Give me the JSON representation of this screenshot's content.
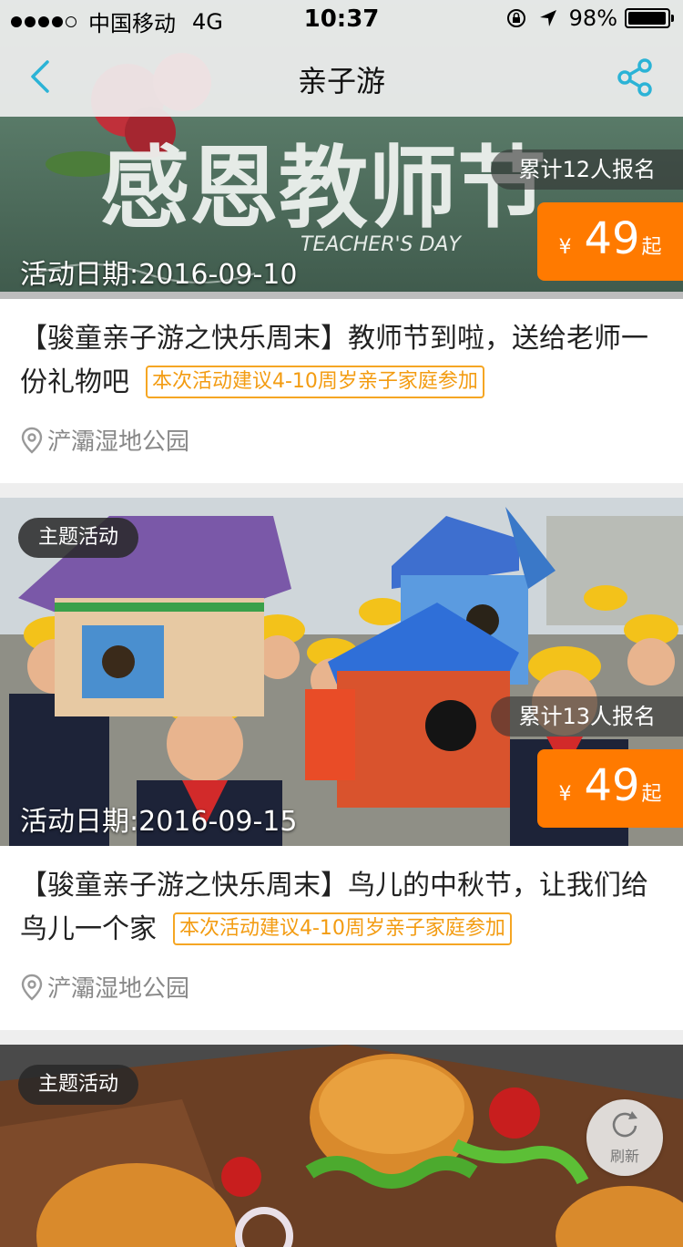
{
  "status_bar": {
    "carrier": "中国移动",
    "network": "4G",
    "time": "10:37",
    "battery": "98%",
    "battery_level": 0.98,
    "signal_bars_filled": 4,
    "signal_bars_total": 5
  },
  "nav": {
    "title": "亲子游",
    "back_icon": "chevron-left-icon",
    "share_icon": "share-icon",
    "accent_color": "#2bb3d6"
  },
  "activities": [
    {
      "registered": "累计12人报名",
      "price_currency": "¥",
      "price_value": "49",
      "price_suffix": "起",
      "date": "活动日期:2016-09-10",
      "banner_text": "感恩教师节",
      "banner_sub": "TEACHER'S DAY",
      "title": "【骏童亲子游之快乐周末】教师节到啦，送给老师一份礼物吧",
      "age_tag": "本次活动建议4-10周岁亲子家庭参加",
      "location": "浐灞湿地公园"
    },
    {
      "theme_tag": "主题活动",
      "registered": "累计13人报名",
      "price_currency": "¥",
      "price_value": "49",
      "price_suffix": "起",
      "date": "活动日期:2016-09-15",
      "title": "【骏童亲子游之快乐周末】鸟儿的中秋节，让我们给鸟儿一个家",
      "age_tag": "本次活动建议4-10周岁亲子家庭参加",
      "location": "浐灞湿地公园"
    },
    {
      "theme_tag": "主题活动"
    }
  ],
  "refresh": {
    "label": "刷新",
    "icon": "refresh-icon"
  },
  "colors": {
    "price_orange": "#ff7a00",
    "age_tag_orange": "#f39c12",
    "nav_accent": "#2bb3d6"
  }
}
